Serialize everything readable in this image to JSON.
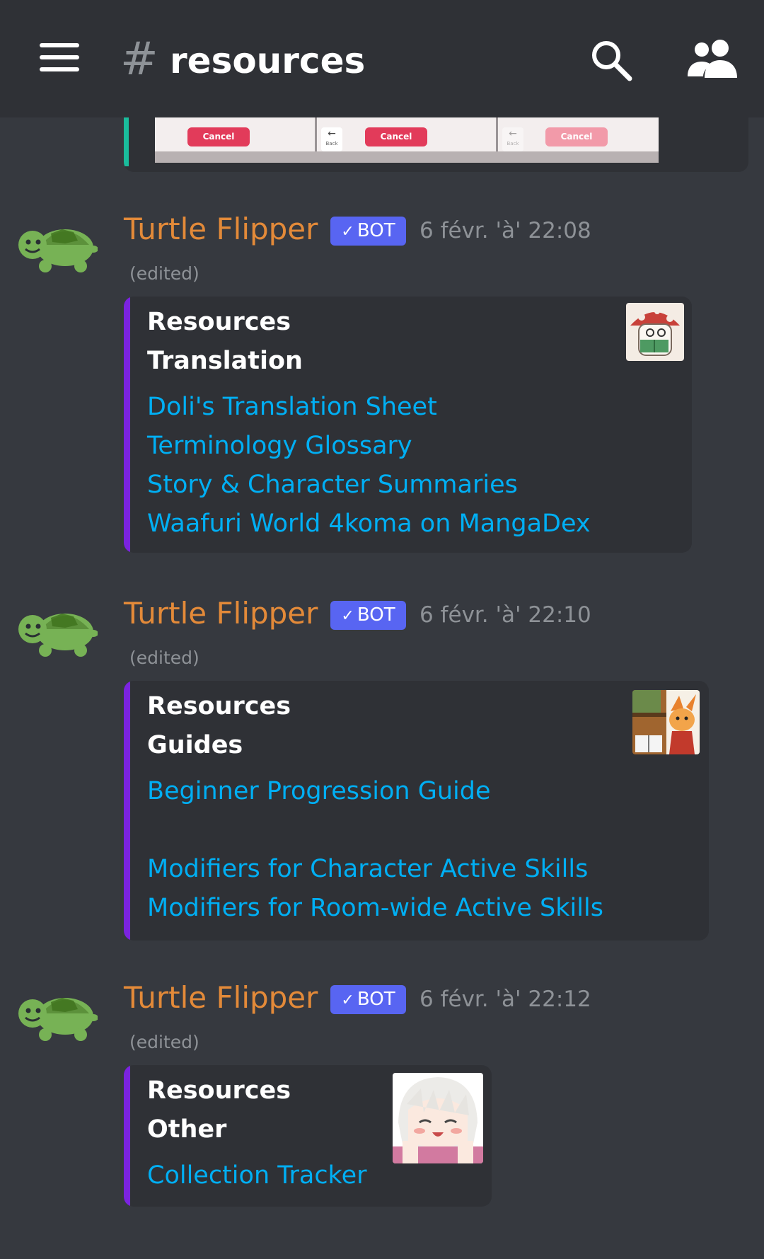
{
  "header": {
    "hash_symbol": "#",
    "channel_name": "resources",
    "menu_icon": "hamburger-menu-icon",
    "search_icon": "search-icon",
    "members_icon": "members-icon"
  },
  "previous_embed": {
    "accent_color": "#1abc9c",
    "cancel_label": "Cancel",
    "back_label": "Back",
    "back_arrow": "←"
  },
  "messages": [
    {
      "author": "Turtle Flipper",
      "badge": "BOT",
      "badge_check": "✓",
      "timestamp": "6 févr. 'à' 22:08",
      "edited": "(edited)",
      "embed": {
        "title": "Resources",
        "subtitle": "Translation",
        "links": [
          "Doli's Translation Sheet",
          "Terminology Glossary",
          "Story & Character Summaries",
          "Waafuri World 4koma on MangaDex"
        ]
      }
    },
    {
      "author": "Turtle Flipper",
      "badge": "BOT",
      "badge_check": "✓",
      "timestamp": "6 févr. 'à' 22:10",
      "edited": "(edited)",
      "embed": {
        "title": "Resources",
        "subtitle": "Guides",
        "links": [
          "Beginner Progression Guide",
          "Modifiers for Character Active Skills",
          "Modifiers for Room-wide Active Skills"
        ]
      }
    },
    {
      "author": "Turtle Flipper",
      "badge": "BOT",
      "badge_check": "✓",
      "timestamp": "6 févr. 'à' 22:12",
      "edited": "(edited)",
      "embed": {
        "title": "Resources",
        "subtitle": "Other",
        "links": [
          "Collection Tracker"
        ]
      }
    }
  ],
  "colors": {
    "background": "#36393f",
    "header": "#2f3136",
    "embed_bg": "#2f3136",
    "embed_accent": "#7b23e0",
    "username": "#e38a39",
    "bot_badge": "#5865f2",
    "link": "#00aff4",
    "muted": "#8e9297"
  }
}
